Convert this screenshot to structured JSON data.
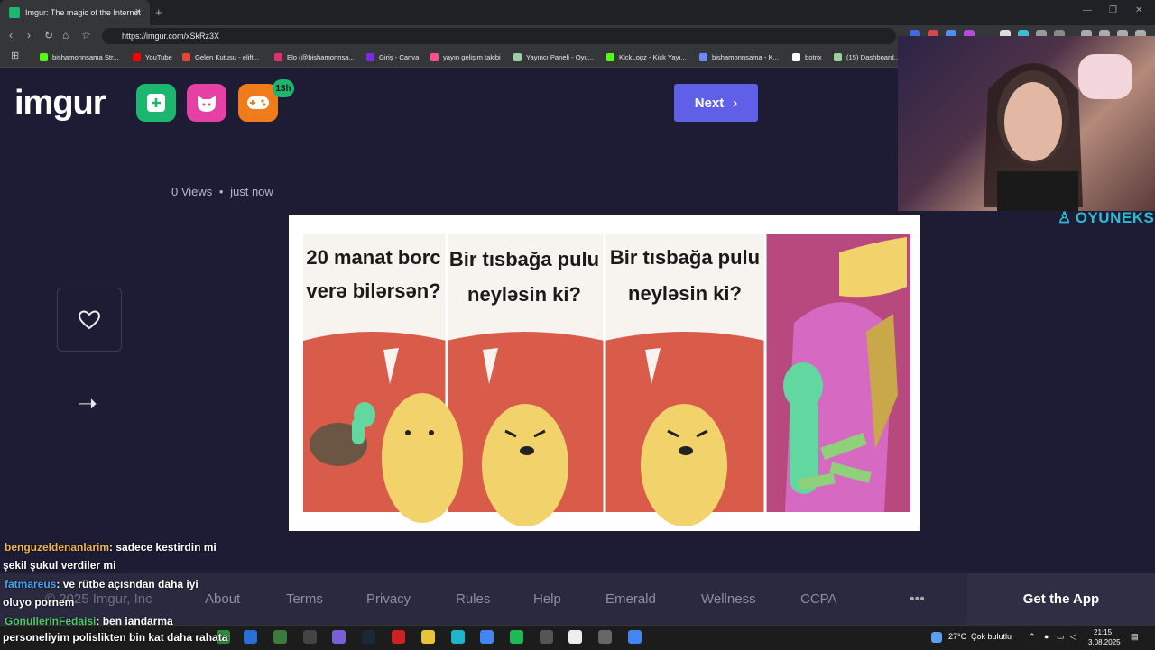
{
  "browser": {
    "tab_title": "Imgur: The magic of the Internet",
    "tab_close": "×",
    "new_tab": "+",
    "url": "https://imgur.com/xSkRz3X",
    "window_controls": [
      "—",
      "❐",
      "✕"
    ]
  },
  "bookmarks": [
    {
      "label": "bishamonnsama Str...",
      "color": "#53fc18"
    },
    {
      "label": "YouTube",
      "color": "#ff0000"
    },
    {
      "label": "Gelen Kutusu - elift...",
      "color": "#ea4335"
    },
    {
      "label": "Elo (@bishamonnsa...",
      "color": "#e1306c"
    },
    {
      "label": "Giriş - Canva",
      "color": "#7d2ae8"
    },
    {
      "label": "yayın gelişim takibi",
      "color": "#ff4f8b"
    },
    {
      "label": "Yayıncı Paneli - Oyu...",
      "color": "#9ad0a0"
    },
    {
      "label": "KickLogz - Kick Yayı...",
      "color": "#53fc18"
    },
    {
      "label": "bishamonnsama - K...",
      "color": "#6a8cff"
    },
    {
      "label": "botrix",
      "color": "#ffffff"
    },
    {
      "label": "(15) Dashboard...",
      "color": "#9ad0a0"
    }
  ],
  "header": {
    "logo": "imgur",
    "badge": "13h",
    "next_label": "Next"
  },
  "post": {
    "meta_views": "0 Views",
    "meta_sep": "•",
    "meta_time": "just now"
  },
  "meme": {
    "panels": [
      {
        "text_line1": "20 manat borc",
        "text_line2": "verə bilərsən?"
      },
      {
        "text_line1": "Bir tısbağa pulu",
        "text_line2": "neyləsin ki?"
      },
      {
        "text_line1": "Bir tısbağa pulu",
        "text_line2": "neyləsin ki?"
      }
    ]
  },
  "webcam": {
    "brand": "OYUNEKS"
  },
  "chat": [
    {
      "user": "benguzeldenanlarim",
      "msg": ": sadece kestirdin mi",
      "cont": "şekil şukul verdiler mi"
    },
    {
      "user": "fatmareus",
      "msg": ": ve rütbe açısndan daha iyi",
      "cont": "oluyo pornem"
    },
    {
      "user": "GonullerinFedaisi",
      "msg": ": ben jandarma",
      "cont": "personeliyim polislikten bin kat daha rahata"
    }
  ],
  "footer": {
    "copyright": "© 2025 Imgur, Inc",
    "links": [
      "About",
      "Terms",
      "Privacy",
      "Rules",
      "Help",
      "Emerald",
      "Wellness",
      "CCPA"
    ],
    "more": "•••",
    "get_app": "Get the App"
  },
  "taskbar": {
    "weather_temp": "27°C",
    "weather_desc": "Çok bulutlu",
    "time": "21:15",
    "date": "3.08.2025"
  }
}
